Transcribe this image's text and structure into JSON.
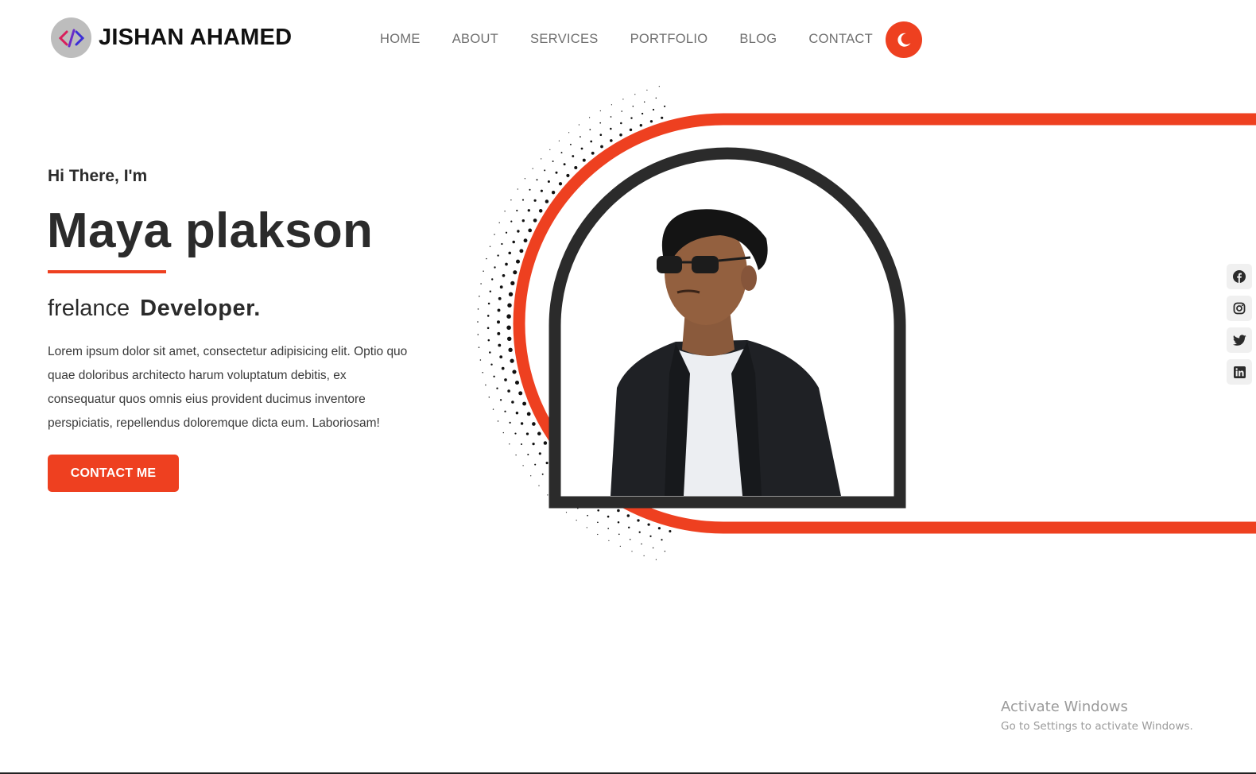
{
  "brand": {
    "name": "JISHAN AHAMED",
    "logo_icon": "code-logo-icon"
  },
  "nav": {
    "items": [
      "HOME",
      "ABOUT",
      "SERVICES",
      "PORTFOLIO",
      "BLOG",
      "CONTACT"
    ]
  },
  "theme_toggle": {
    "icon": "moon-icon"
  },
  "hero": {
    "greeting": "Hi There, I'm",
    "name": "Maya plakson",
    "role_prefix": "frelance",
    "role_main": "Developer.",
    "bio": "Lorem ipsum dolor sit amet, consectetur adipisicing elit. Optio quo quae doloribus architecto harum voluptatum debitis, ex consequatur quos omnis eius provident ducimus inventore perspiciatis, repellendus doloremque dicta eum. Laboriosam!",
    "cta_label": "CONTACT ME"
  },
  "social": {
    "icons": [
      "facebook-icon",
      "instagram-icon",
      "twitter-icon",
      "linkedin-icon"
    ]
  },
  "watermark": {
    "title": "Activate Windows",
    "subtitle": "Go to Settings to activate Windows."
  },
  "colors": {
    "accent": "#ee4020",
    "text": "#2b2b2b",
    "nav": "#6f6f6f",
    "frame": "#2b2b2b"
  }
}
